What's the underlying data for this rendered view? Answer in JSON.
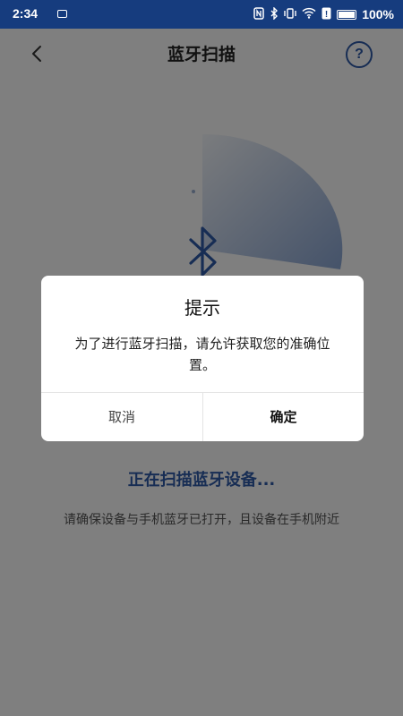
{
  "status_bar": {
    "time": "2:34",
    "battery_percent": "100%",
    "icons": [
      "nfc-icon",
      "bluetooth-icon",
      "vibrate-icon",
      "wifi-icon",
      "sim-icon",
      "battery-icon"
    ]
  },
  "header": {
    "title": "蓝牙扫描",
    "back_icon": "chevron-left-icon",
    "help_icon": "question-circle-icon",
    "help_symbol": "?"
  },
  "scan": {
    "status": "正在扫描蓝牙设备...",
    "hint": "请确保设备与手机蓝牙已打开，且设备在手机附近",
    "radar_icon": "bluetooth-icon"
  },
  "dialog": {
    "title": "提示",
    "message": "为了进行蓝牙扫描，请允许获取您的准确位置。",
    "cancel_label": "取消",
    "confirm_label": "确定"
  },
  "colors": {
    "status_bar": "#163c7e",
    "accent": "#2e5aa8",
    "overlay": "rgba(0,0,0,0.5)"
  }
}
